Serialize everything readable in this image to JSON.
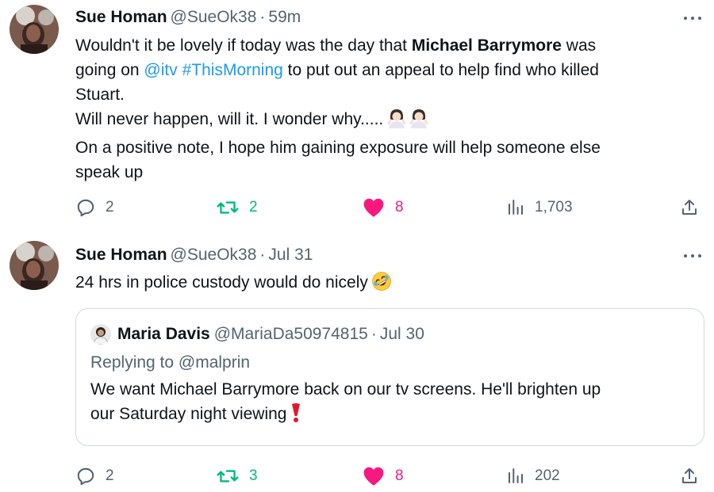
{
  "colors": {
    "text": "#0f1419",
    "secondary": "#536471",
    "link": "#1d9bf0",
    "retweet": "#00ba7c",
    "like": "#f91880",
    "border": "#cfd9de"
  },
  "tweets": [
    {
      "author": {
        "name": "Sue Homan",
        "handle": "@SueOk38",
        "separator": "·",
        "time": "59m"
      },
      "body": {
        "line1_pre": "Wouldn't it be lovely if today was the day that ",
        "line1_bold": "Michael Barrymore",
        "line1_post": " was",
        "line2_pre": "going on ",
        "mention": "@itv",
        "hashtag": "#ThisMorning",
        "line2_post": " to put out an appeal to help find who killed",
        "line3": "Stuart.",
        "line4": "Will never happen, will it. I wonder why.....",
        "line4_emoji": "person-shrugging-emoji x2",
        "line5": "On a positive note, I hope him gaining exposure will help someone else",
        "line6": "speak up"
      },
      "actions": {
        "replies": "2",
        "retweets": "2",
        "likes": "8",
        "views": "1,703"
      },
      "liked": true
    },
    {
      "author": {
        "name": "Sue Homan",
        "handle": "@SueOk38",
        "separator": "·",
        "time": "Jul 31"
      },
      "body": {
        "line1": "24 hrs in police custody would do nicely",
        "line1_emoji": "rolling-on-floor-laughing-emoji"
      },
      "quote": {
        "author": {
          "name": "Maria Davis",
          "handle": "@MariaDa50974815",
          "separator": "·",
          "time": "Jul 30"
        },
        "replying_prefix": "Replying to ",
        "replying_to": "@malprin",
        "line1": "We want Michael Barrymore back on our tv screens.  He'll brighten up",
        "line2": "our Saturday night viewing",
        "line2_emoji": "red-exclamation-emoji"
      },
      "actions": {
        "replies": "2",
        "retweets": "3",
        "likes": "8",
        "views": "202"
      },
      "liked": true
    }
  ]
}
